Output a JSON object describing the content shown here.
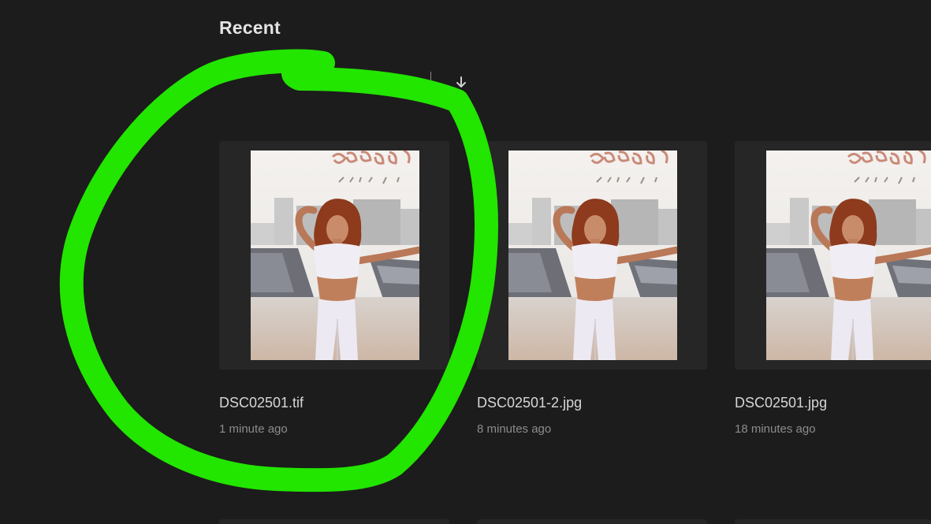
{
  "section": {
    "title": "Recent"
  },
  "sort": {
    "icon": "arrow-down-icon"
  },
  "files": [
    {
      "name": "DSC02501.tif",
      "time": "1 minute ago"
    },
    {
      "name": "DSC02501-2.jpg",
      "time": "8 minutes ago"
    },
    {
      "name": "DSC02501.jpg",
      "time": "18 minutes ago"
    }
  ],
  "colors": {
    "background": "#1c1c1c",
    "card": "#262626",
    "annotation": "#22e500"
  }
}
